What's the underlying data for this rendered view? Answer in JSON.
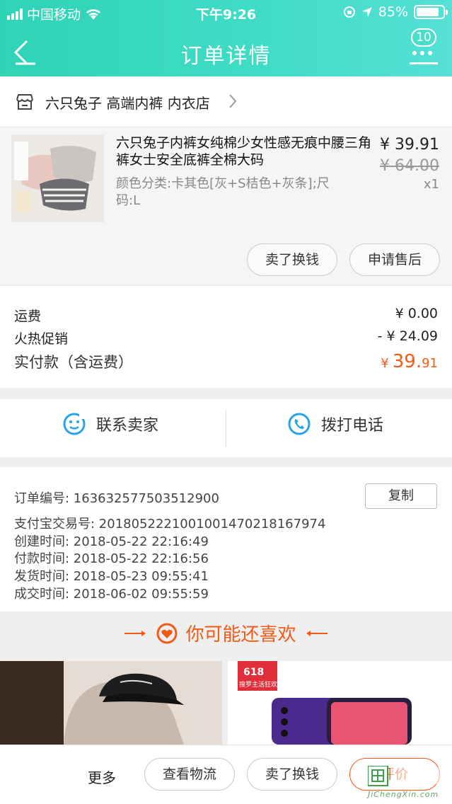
{
  "status_bar": {
    "carrier": "中国移动",
    "time": "下午9:26",
    "battery": "85%"
  },
  "header": {
    "title": "订单详情",
    "badge_count": "10"
  },
  "shop": {
    "name": "六只兔子 高端内裤 内衣店"
  },
  "product": {
    "title": "六只兔子内裤女纯棉少女性感无痕中腰三角裤女士安全底裤全棉大码",
    "attributes": "颜色分类:卡其色[灰+S桔色+灰条];尺码:L",
    "price": "¥ 39.91",
    "original_price": "¥ 64.00",
    "quantity": "x1",
    "actions": {
      "resell": "卖了换钱",
      "after_sale": "申请售后"
    }
  },
  "fees": {
    "shipping_label": "运费",
    "shipping_value": "¥ 0.00",
    "promo_label": "火热促销",
    "promo_value": "- ¥ 24.09",
    "paid_label": "实付款（含运费）",
    "paid_currency": "¥",
    "paid_int": "39.",
    "paid_dec": "91"
  },
  "contact": {
    "seller": "联系卖家",
    "phone": "拨打电话"
  },
  "order_info": {
    "order_no": "订单编号:  1636325775035129​00",
    "alipay_no": "支付宝交易号:  2018052221001001470218167974",
    "created": "创建时间:  2018-05-22 22:16:49",
    "paid": "付款时间:  2018-05-22 22:16:56",
    "shipped": "发货时间:  2018-05-23 09:55:41",
    "completed": "成交时间:  2018-06-02 09:55:59",
    "copy": "复制"
  },
  "recommend": {
    "title": "你可能还喜欢",
    "tag_618": "618",
    "tag_sub": "搜罗主活狂欢季"
  },
  "bottom_bar": {
    "more": "更多",
    "logistics": "查看物流",
    "resell": "卖了换钱",
    "review": "评价"
  },
  "watermark": {
    "text": "JiChengXin.com"
  },
  "colors": {
    "header_start": "#2fd3b6",
    "accent_orange": "#f25a16",
    "icon_blue": "#2aa3e8"
  }
}
